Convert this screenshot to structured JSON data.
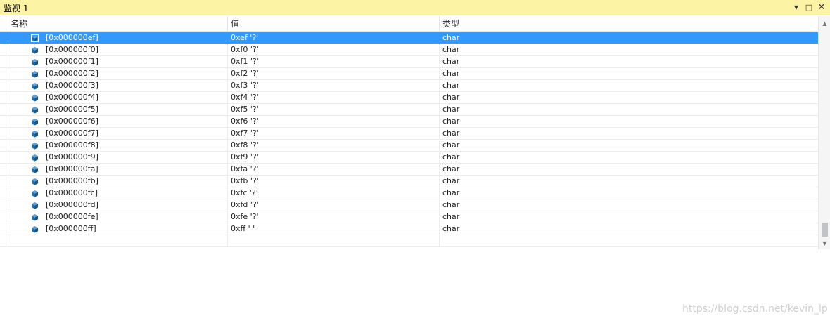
{
  "window": {
    "title": "监视 1",
    "controls": {
      "dropdown": "▼",
      "maximize": "□",
      "close": "✕"
    }
  },
  "columns": {
    "name": "名称",
    "value": "值",
    "type": "类型"
  },
  "selection_color": "#3399ff",
  "icon_color": "#1f6fb0",
  "rows": [
    {
      "name": "[0x000000ef]",
      "value": "0xef '?'",
      "type": "char"
    },
    {
      "name": "[0x000000f0]",
      "value": "0xf0 '?'",
      "type": "char"
    },
    {
      "name": "[0x000000f1]",
      "value": "0xf1 '?'",
      "type": "char"
    },
    {
      "name": "[0x000000f2]",
      "value": "0xf2 '?'",
      "type": "char"
    },
    {
      "name": "[0x000000f3]",
      "value": "0xf3 '?'",
      "type": "char"
    },
    {
      "name": "[0x000000f4]",
      "value": "0xf4 '?'",
      "type": "char"
    },
    {
      "name": "[0x000000f5]",
      "value": "0xf5 '?'",
      "type": "char"
    },
    {
      "name": "[0x000000f6]",
      "value": "0xf6 '?'",
      "type": "char"
    },
    {
      "name": "[0x000000f7]",
      "value": "0xf7 '?'",
      "type": "char"
    },
    {
      "name": "[0x000000f8]",
      "value": "0xf8 '?'",
      "type": "char"
    },
    {
      "name": "[0x000000f9]",
      "value": "0xf9 '?'",
      "type": "char"
    },
    {
      "name": "[0x000000fa]",
      "value": "0xfa '?'",
      "type": "char"
    },
    {
      "name": "[0x000000fb]",
      "value": "0xfb '?'",
      "type": "char"
    },
    {
      "name": "[0x000000fc]",
      "value": "0xfc '?'",
      "type": "char"
    },
    {
      "name": "[0x000000fd]",
      "value": "0xfd '?'",
      "type": "char"
    },
    {
      "name": "[0x000000fe]",
      "value": "0xfe '?'",
      "type": "char"
    },
    {
      "name": "[0x000000ff]",
      "value": "0xff '  '",
      "type": "char"
    }
  ],
  "scrollbar": {
    "up": "▲",
    "down": "▼"
  },
  "watermark": "https://blog.csdn.net/kevin_lp"
}
